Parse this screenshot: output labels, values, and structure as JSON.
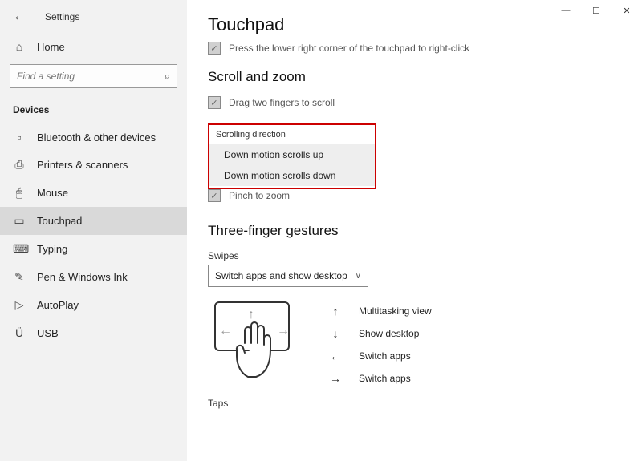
{
  "window": {
    "title": "Settings",
    "controls": {
      "min": "—",
      "max": "☐",
      "close": "✕"
    }
  },
  "sidebar": {
    "home": "Home",
    "search_placeholder": "Find a setting",
    "category": "Devices",
    "items": [
      {
        "icon": "bluetooth",
        "label": "Bluetooth & other devices"
      },
      {
        "icon": "printer",
        "label": "Printers & scanners"
      },
      {
        "icon": "mouse",
        "label": "Mouse"
      },
      {
        "icon": "touchpad",
        "label": "Touchpad",
        "selected": true
      },
      {
        "icon": "typing",
        "label": "Typing"
      },
      {
        "icon": "pen",
        "label": "Pen & Windows Ink"
      },
      {
        "icon": "autoplay",
        "label": "AutoPlay"
      },
      {
        "icon": "usb",
        "label": "USB"
      }
    ]
  },
  "main": {
    "title": "Touchpad",
    "press_corner": "Press the lower right corner of the touchpad to right-click",
    "scroll_zoom_header": "Scroll and zoom",
    "drag_two": "Drag two fingers to scroll",
    "scroll_dir_label": "Scrolling direction",
    "scroll_options": [
      "Down motion scrolls up",
      "Down motion scrolls down"
    ],
    "pinch": "Pinch to zoom",
    "three_finger_header": "Three-finger gestures",
    "swipes_label": "Swipes",
    "swipes_value": "Switch apps and show desktop",
    "gestures": [
      {
        "dir": "↑",
        "label": "Multitasking view"
      },
      {
        "dir": "↓",
        "label": "Show desktop"
      },
      {
        "dir": "←",
        "label": "Switch apps"
      },
      {
        "dir": "→",
        "label": "Switch apps"
      }
    ],
    "taps_label": "Taps"
  }
}
